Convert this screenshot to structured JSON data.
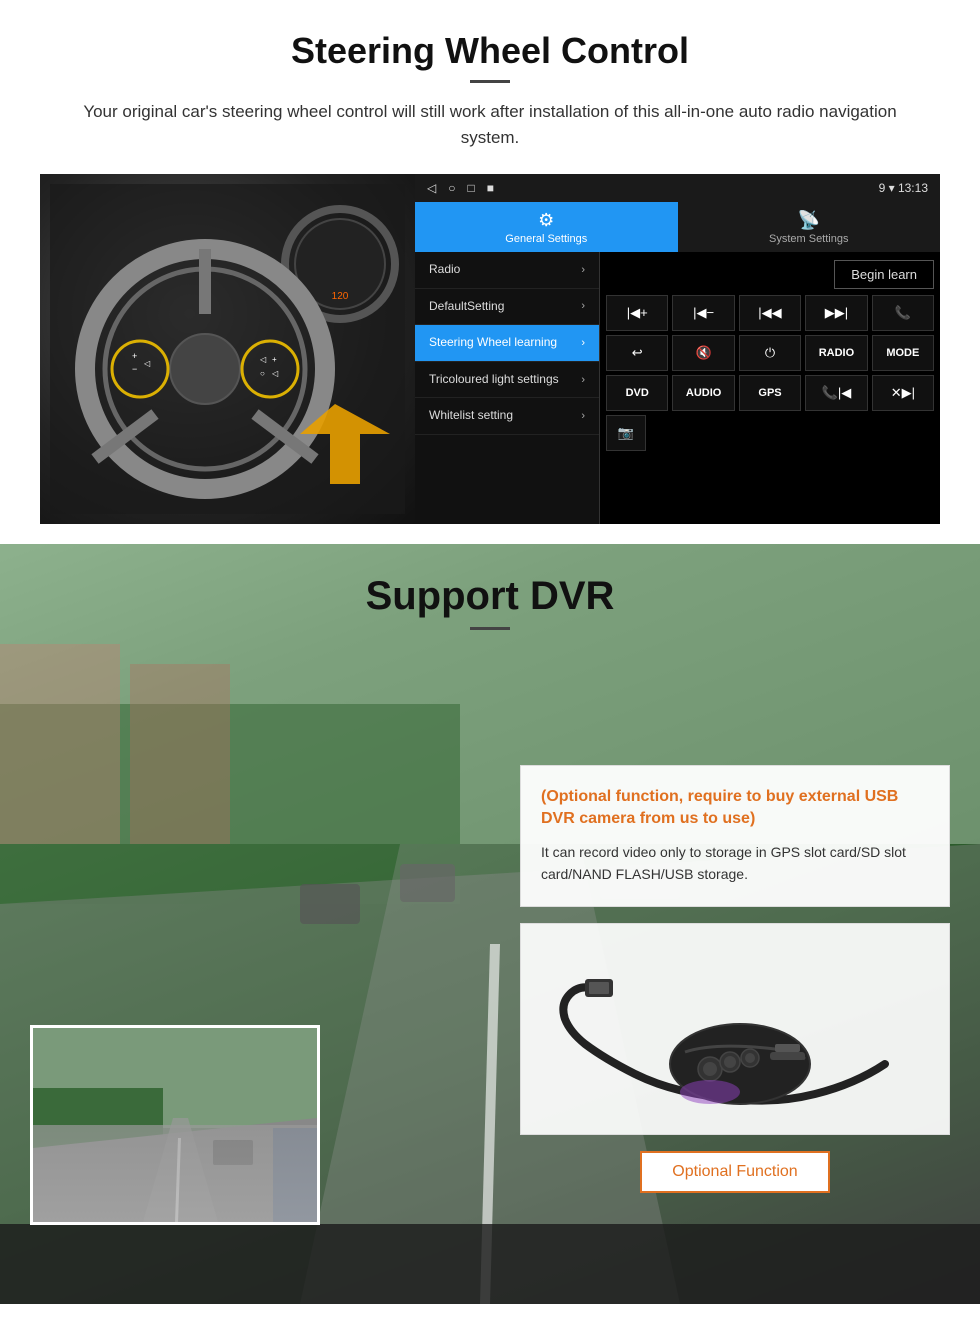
{
  "steering": {
    "title": "Steering Wheel Control",
    "subtitle": "Your original car's steering wheel control will still work after installation of this all-in-one auto radio navigation system.",
    "statusbar": {
      "icons": [
        "◁",
        "○",
        "□",
        "■"
      ],
      "time": "9 ▾ 13:13"
    },
    "tabs": [
      {
        "label": "General Settings",
        "icon": "⚙",
        "active": true
      },
      {
        "label": "System Settings",
        "icon": "📡",
        "active": false
      }
    ],
    "menu": [
      {
        "label": "Radio",
        "active": false
      },
      {
        "label": "DefaultSetting",
        "active": false
      },
      {
        "label": "Steering Wheel learning",
        "active": true
      },
      {
        "label": "Tricoloured light settings",
        "active": false
      },
      {
        "label": "Whitelist setting",
        "active": false
      }
    ],
    "begin_learn_label": "Begin learn",
    "controls": [
      {
        "label": "◀◀+",
        "row": 1
      },
      {
        "label": "◀◀−",
        "row": 1
      },
      {
        "label": "◀◀",
        "row": 1
      },
      {
        "label": "▶▶",
        "row": 1
      },
      {
        "label": "📞",
        "row": 1
      },
      {
        "label": "↩",
        "row": 2
      },
      {
        "label": "🔇",
        "row": 2
      },
      {
        "label": "⏻",
        "row": 2
      },
      {
        "label": "RADIO",
        "row": 2
      },
      {
        "label": "MODE",
        "row": 2
      },
      {
        "label": "DVD",
        "row": 3
      },
      {
        "label": "AUDIO",
        "row": 3
      },
      {
        "label": "GPS",
        "row": 3
      },
      {
        "label": "📞◀◀",
        "row": 3
      },
      {
        "label": "✕▶▶",
        "row": 3
      },
      {
        "label": "📷",
        "row": 4
      }
    ]
  },
  "dvr": {
    "title": "Support DVR",
    "optional_text": "(Optional function, require to buy external USB DVR camera from us to use)",
    "desc_text": "It can record video only to storage in GPS slot card/SD slot card/NAND FLASH/USB storage.",
    "optional_btn_label": "Optional Function"
  }
}
